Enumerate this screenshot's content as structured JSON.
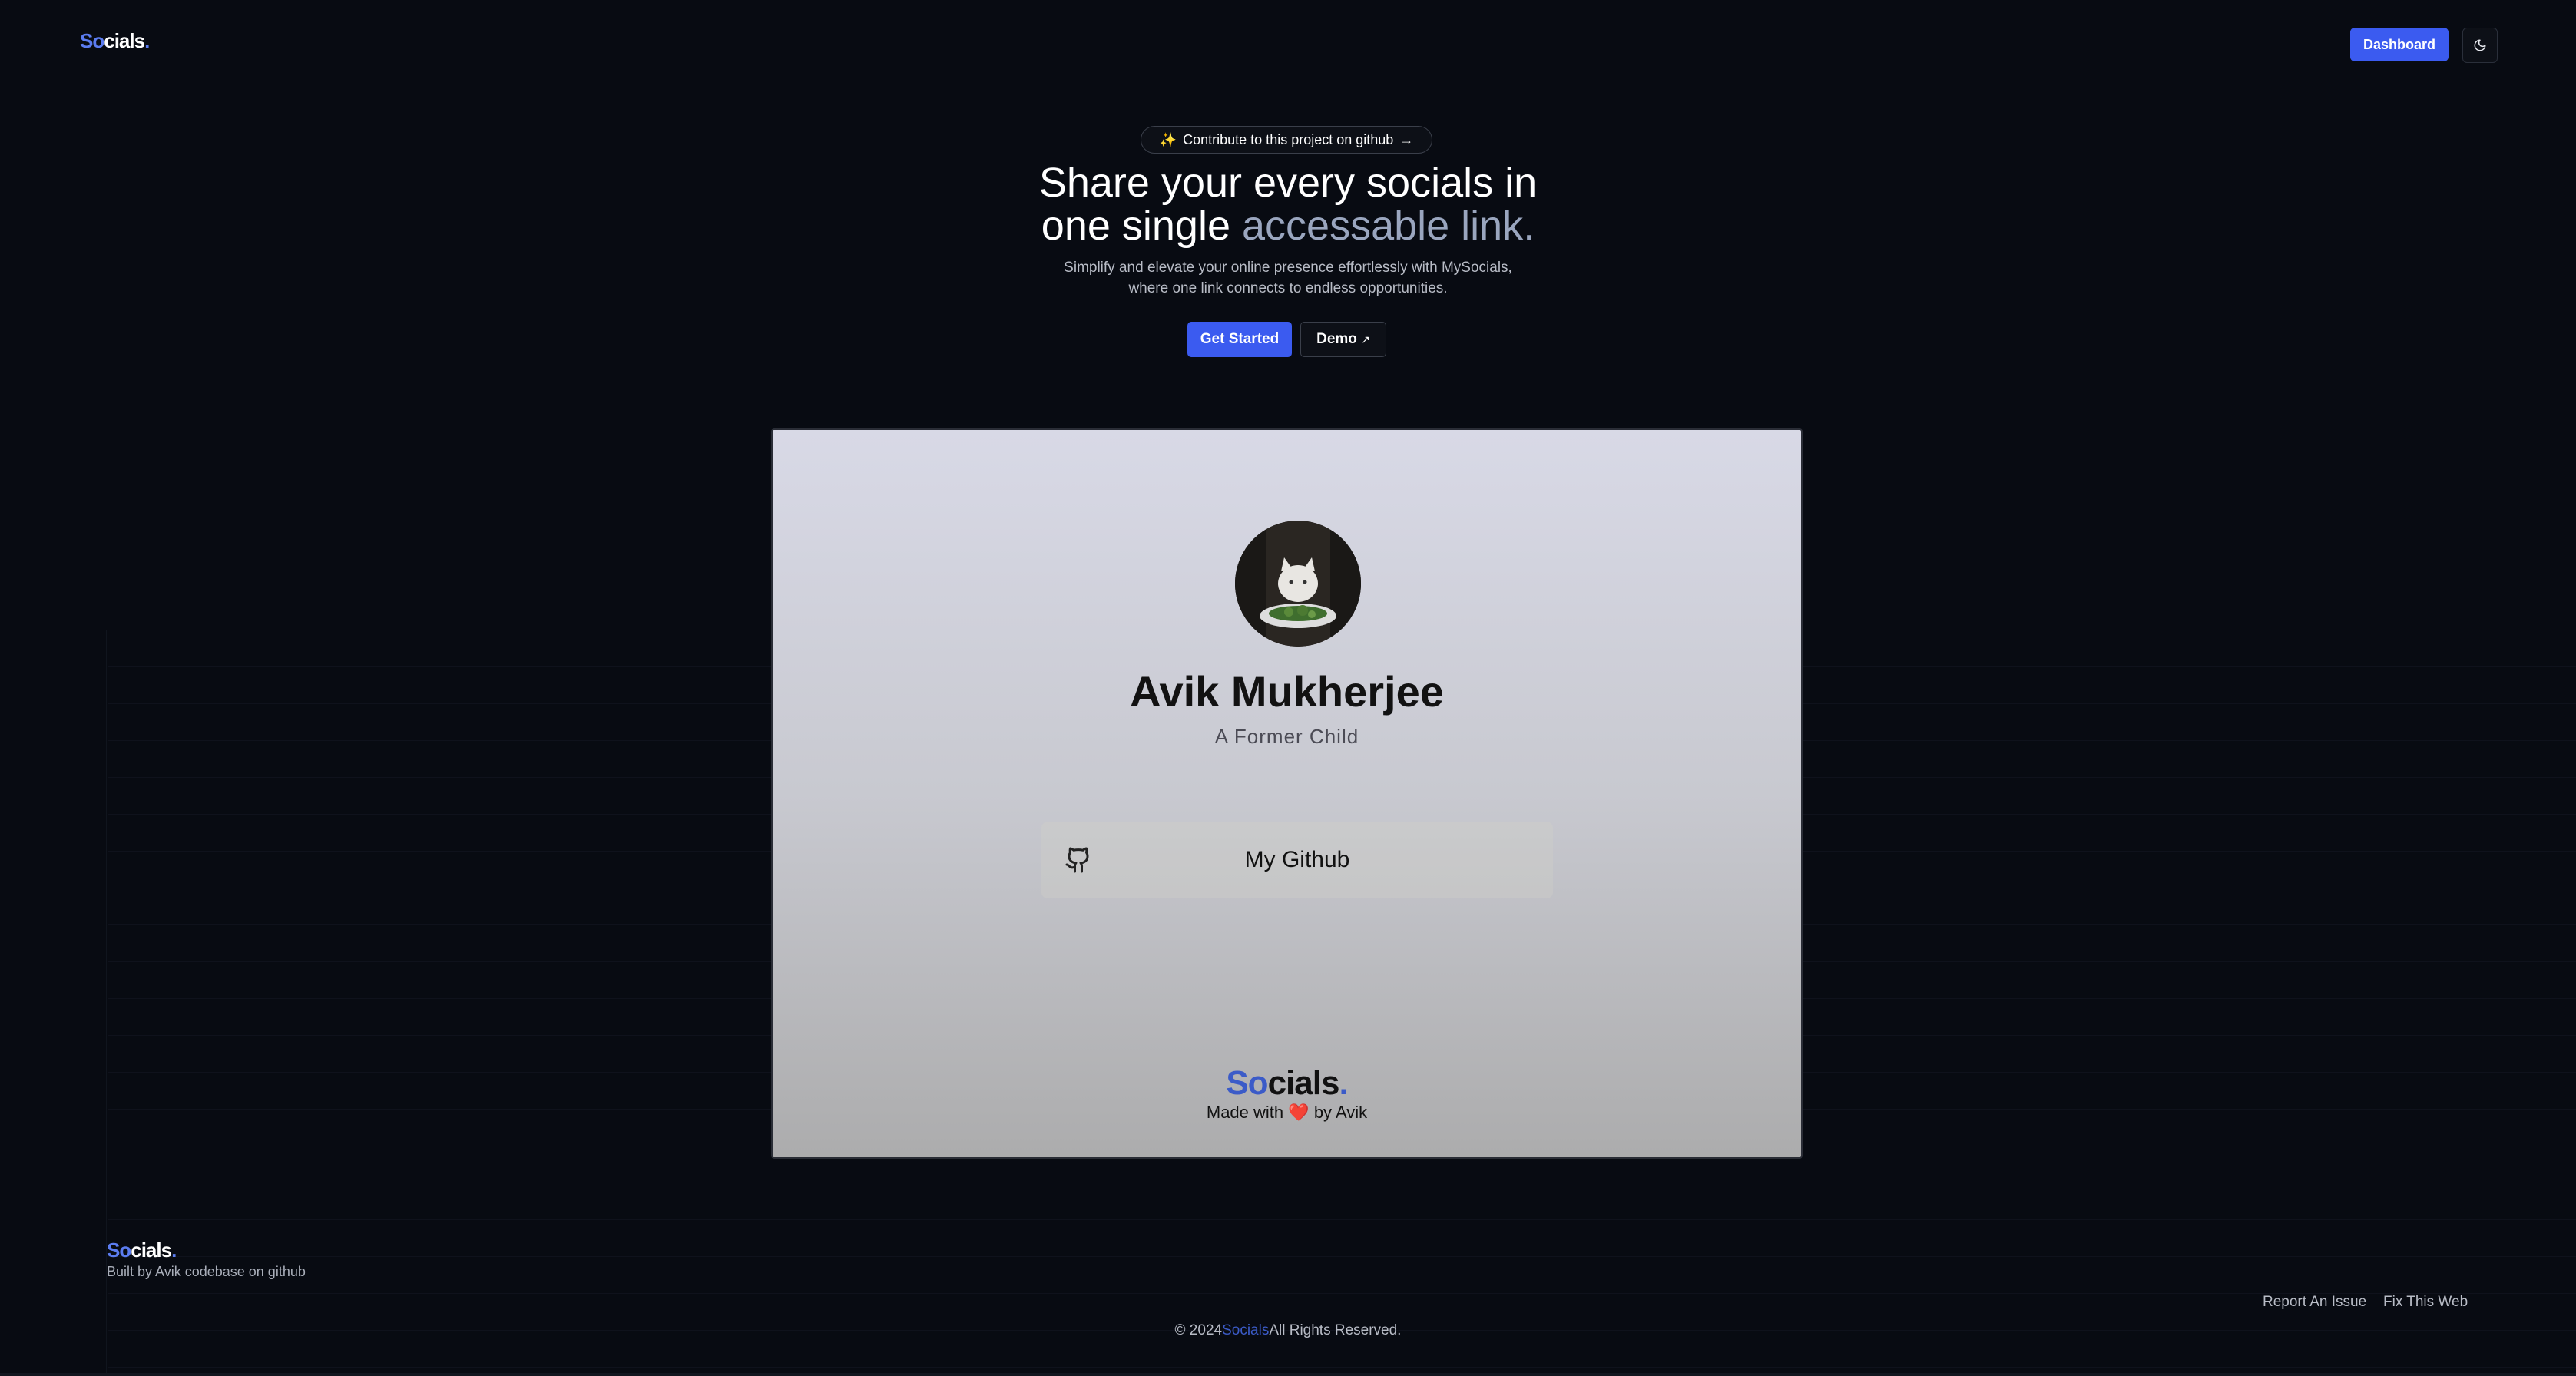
{
  "nav": {
    "logo_so": "So",
    "logo_rest": "cials",
    "logo_dot": ".",
    "dashboard_label": "Dashboard",
    "theme_icon": "moon-icon"
  },
  "hero": {
    "contribute_icon": "✨",
    "contribute_label": "Contribute to this project on github",
    "contribute_arrow": "→",
    "title_line1": "Share your every socials in",
    "title_line2_plain": "one single ",
    "title_line2_muted": "accessable link.",
    "subtitle_line1": "Simplify and elevate your online presence effortlessly with MySocials,",
    "subtitle_line2": "where one link connects to endless opportunities.",
    "get_started_label": "Get Started",
    "demo_label": "Demo",
    "demo_arrow": "↗"
  },
  "preview": {
    "name": "Avik Mukherjee",
    "bio": "A Former Child",
    "links": [
      {
        "label": "My Github",
        "icon": "github-icon"
      }
    ],
    "logo_so": "So",
    "logo_rest": "cials",
    "logo_dot": ".",
    "made_prefix": "Made with",
    "made_heart": "❤️",
    "made_suffix": "by Avik"
  },
  "footer": {
    "logo_so": "So",
    "logo_rest": "cials",
    "logo_dot": ".",
    "built_by": "Built by Avik codebase on github",
    "report_issue": "Report An Issue",
    "fix_web": "Fix This Web",
    "copyright_prefix": "© 2024",
    "copyright_brand": "Socials",
    "copyright_suffix": "All Rights Reserved."
  },
  "colors": {
    "background": "#080b12",
    "accent": "#3b5bf0",
    "muted_title": "#9aa6bf"
  }
}
